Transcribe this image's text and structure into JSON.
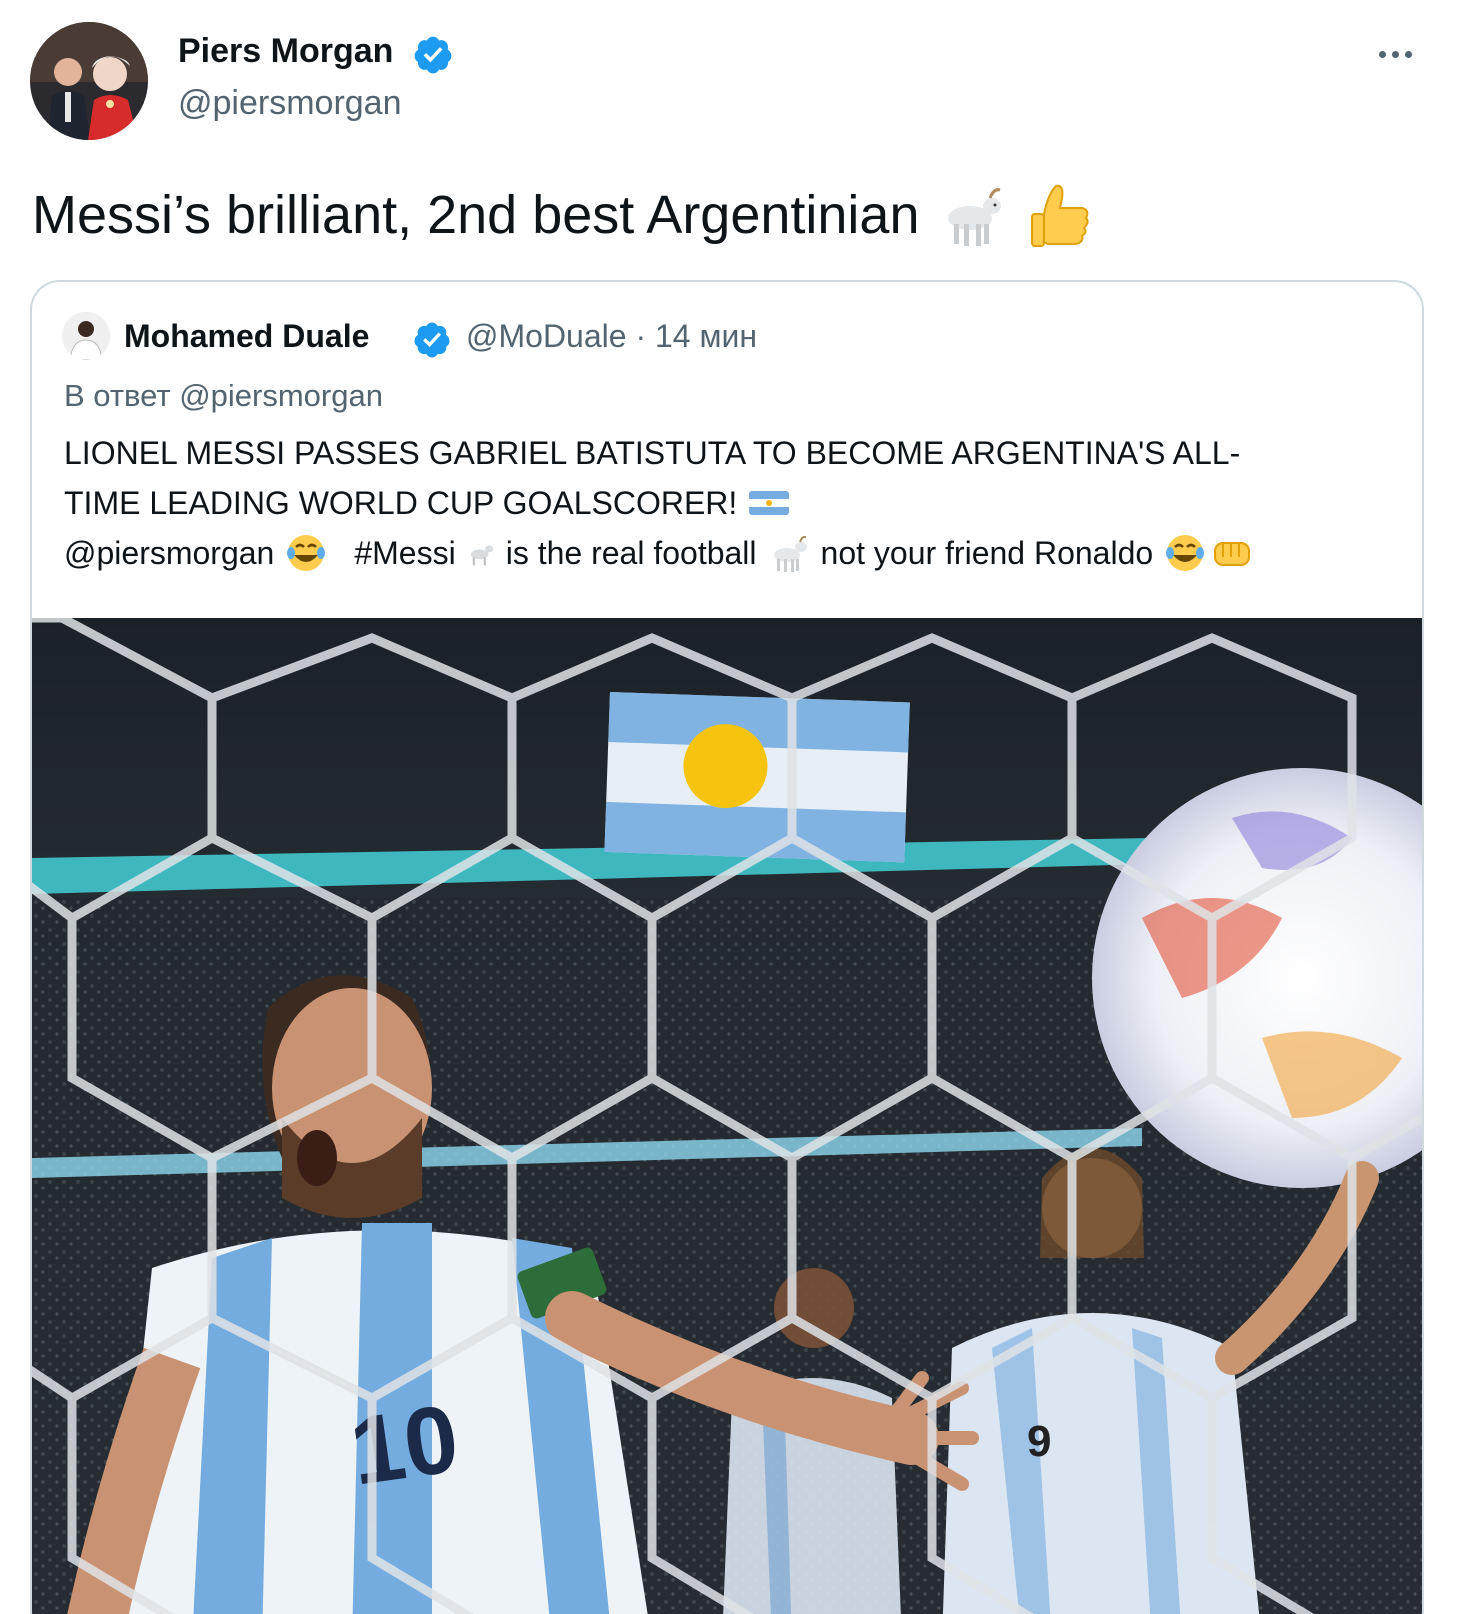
{
  "author": {
    "name": "Piers Morgan",
    "handle": "@piersmorgan"
  },
  "tweet": {
    "text": "Messi’s brilliant, 2nd best Argentinian"
  },
  "quoted": {
    "name": "Mohamed Duale",
    "meta": "@MoDuale · 14 мин",
    "reply_to": "В ответ @piersmorgan",
    "line1": "LIONEL MESSI PASSES GABRIEL BATISTUTA TO BECOME ARGENTINA'S ALL-",
    "line2": "TIME LEADING WORLD CUP GOALSCORER!",
    "line3_mention": "@piersmorgan",
    "line3_hashtag": "#Messi",
    "line3_mid": "is the real football",
    "line3_end": "not your friend Ronaldo",
    "photo_numbers": [
      "10",
      "9"
    ]
  },
  "colors": {
    "verified": "#1d9bf0",
    "secondary_text": "#536471",
    "border": "#cfd9de"
  }
}
